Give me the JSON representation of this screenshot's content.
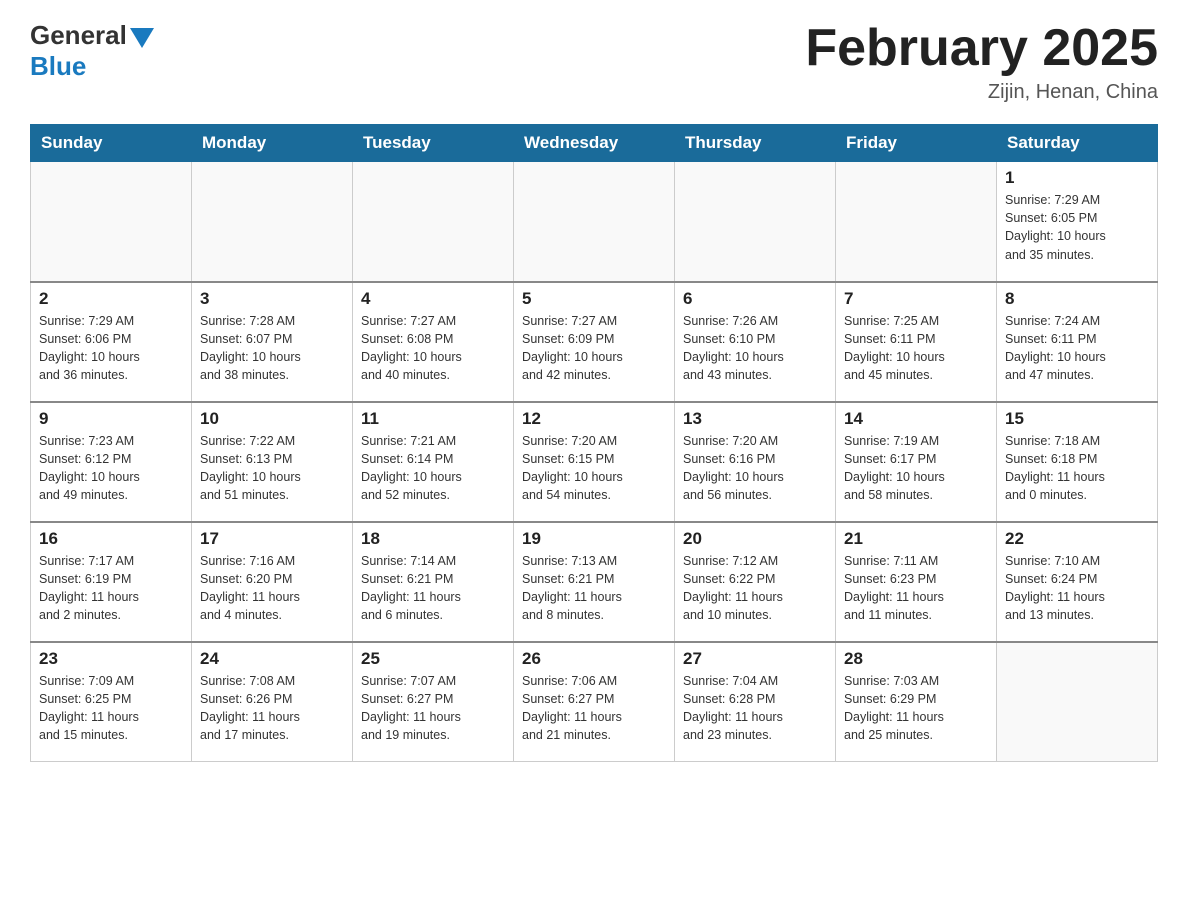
{
  "header": {
    "logo_text_general": "General",
    "logo_text_blue": "Blue",
    "month_title": "February 2025",
    "location": "Zijin, Henan, China"
  },
  "weekdays": [
    "Sunday",
    "Monday",
    "Tuesday",
    "Wednesday",
    "Thursday",
    "Friday",
    "Saturday"
  ],
  "weeks": [
    [
      {
        "day": "",
        "info": ""
      },
      {
        "day": "",
        "info": ""
      },
      {
        "day": "",
        "info": ""
      },
      {
        "day": "",
        "info": ""
      },
      {
        "day": "",
        "info": ""
      },
      {
        "day": "",
        "info": ""
      },
      {
        "day": "1",
        "info": "Sunrise: 7:29 AM\nSunset: 6:05 PM\nDaylight: 10 hours\nand 35 minutes."
      }
    ],
    [
      {
        "day": "2",
        "info": "Sunrise: 7:29 AM\nSunset: 6:06 PM\nDaylight: 10 hours\nand 36 minutes."
      },
      {
        "day": "3",
        "info": "Sunrise: 7:28 AM\nSunset: 6:07 PM\nDaylight: 10 hours\nand 38 minutes."
      },
      {
        "day": "4",
        "info": "Sunrise: 7:27 AM\nSunset: 6:08 PM\nDaylight: 10 hours\nand 40 minutes."
      },
      {
        "day": "5",
        "info": "Sunrise: 7:27 AM\nSunset: 6:09 PM\nDaylight: 10 hours\nand 42 minutes."
      },
      {
        "day": "6",
        "info": "Sunrise: 7:26 AM\nSunset: 6:10 PM\nDaylight: 10 hours\nand 43 minutes."
      },
      {
        "day": "7",
        "info": "Sunrise: 7:25 AM\nSunset: 6:11 PM\nDaylight: 10 hours\nand 45 minutes."
      },
      {
        "day": "8",
        "info": "Sunrise: 7:24 AM\nSunset: 6:11 PM\nDaylight: 10 hours\nand 47 minutes."
      }
    ],
    [
      {
        "day": "9",
        "info": "Sunrise: 7:23 AM\nSunset: 6:12 PM\nDaylight: 10 hours\nand 49 minutes."
      },
      {
        "day": "10",
        "info": "Sunrise: 7:22 AM\nSunset: 6:13 PM\nDaylight: 10 hours\nand 51 minutes."
      },
      {
        "day": "11",
        "info": "Sunrise: 7:21 AM\nSunset: 6:14 PM\nDaylight: 10 hours\nand 52 minutes."
      },
      {
        "day": "12",
        "info": "Sunrise: 7:20 AM\nSunset: 6:15 PM\nDaylight: 10 hours\nand 54 minutes."
      },
      {
        "day": "13",
        "info": "Sunrise: 7:20 AM\nSunset: 6:16 PM\nDaylight: 10 hours\nand 56 minutes."
      },
      {
        "day": "14",
        "info": "Sunrise: 7:19 AM\nSunset: 6:17 PM\nDaylight: 10 hours\nand 58 minutes."
      },
      {
        "day": "15",
        "info": "Sunrise: 7:18 AM\nSunset: 6:18 PM\nDaylight: 11 hours\nand 0 minutes."
      }
    ],
    [
      {
        "day": "16",
        "info": "Sunrise: 7:17 AM\nSunset: 6:19 PM\nDaylight: 11 hours\nand 2 minutes."
      },
      {
        "day": "17",
        "info": "Sunrise: 7:16 AM\nSunset: 6:20 PM\nDaylight: 11 hours\nand 4 minutes."
      },
      {
        "day": "18",
        "info": "Sunrise: 7:14 AM\nSunset: 6:21 PM\nDaylight: 11 hours\nand 6 minutes."
      },
      {
        "day": "19",
        "info": "Sunrise: 7:13 AM\nSunset: 6:21 PM\nDaylight: 11 hours\nand 8 minutes."
      },
      {
        "day": "20",
        "info": "Sunrise: 7:12 AM\nSunset: 6:22 PM\nDaylight: 11 hours\nand 10 minutes."
      },
      {
        "day": "21",
        "info": "Sunrise: 7:11 AM\nSunset: 6:23 PM\nDaylight: 11 hours\nand 11 minutes."
      },
      {
        "day": "22",
        "info": "Sunrise: 7:10 AM\nSunset: 6:24 PM\nDaylight: 11 hours\nand 13 minutes."
      }
    ],
    [
      {
        "day": "23",
        "info": "Sunrise: 7:09 AM\nSunset: 6:25 PM\nDaylight: 11 hours\nand 15 minutes."
      },
      {
        "day": "24",
        "info": "Sunrise: 7:08 AM\nSunset: 6:26 PM\nDaylight: 11 hours\nand 17 minutes."
      },
      {
        "day": "25",
        "info": "Sunrise: 7:07 AM\nSunset: 6:27 PM\nDaylight: 11 hours\nand 19 minutes."
      },
      {
        "day": "26",
        "info": "Sunrise: 7:06 AM\nSunset: 6:27 PM\nDaylight: 11 hours\nand 21 minutes."
      },
      {
        "day": "27",
        "info": "Sunrise: 7:04 AM\nSunset: 6:28 PM\nDaylight: 11 hours\nand 23 minutes."
      },
      {
        "day": "28",
        "info": "Sunrise: 7:03 AM\nSunset: 6:29 PM\nDaylight: 11 hours\nand 25 minutes."
      },
      {
        "day": "",
        "info": ""
      }
    ]
  ]
}
